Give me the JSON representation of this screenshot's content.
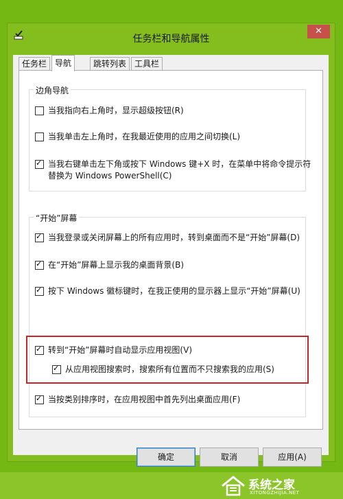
{
  "window": {
    "title": "任务栏和导航属性",
    "close_symbol": "✕"
  },
  "tabs": [
    {
      "label": "任务栏"
    },
    {
      "label": "导航"
    },
    {
      "label": "跳转列表"
    },
    {
      "label": "工具栏"
    }
  ],
  "active_tab": "导航",
  "corner_navigation": {
    "title": "边角导航",
    "options": [
      {
        "label": "当我指向右上角时，显示超级按钮(R)",
        "checked": false
      },
      {
        "label": "当我单击左上角时，在我最近使用的应用之间切换(L)",
        "checked": false
      },
      {
        "label_line1": "当我右键单击左下角或按下 Windows 键+X 时，在菜单中将命令提示符",
        "label_line2": "替换为 Windows PowerShell(C)",
        "checked": true
      }
    ]
  },
  "start_screen": {
    "title": "“开始”屏幕",
    "options": [
      {
        "label": "当我登录或关闭屏幕上的所有应用时，转到桌面而不是“开始”屏幕(D)",
        "checked": true
      },
      {
        "label": "在“开始”屏幕上显示我的桌面背景(B)",
        "checked": true
      },
      {
        "label": "按下 Windows 徽标键时，在我正使用的显示器上显示“开始”屏幕(U)",
        "checked": true
      },
      {
        "label": "转到“开始”屏幕时自动显示应用视图(V)",
        "checked": true
      },
      {
        "label": "从应用视图搜索时，搜索所有位置而不只搜索我的应用(S)",
        "checked": true
      },
      {
        "label": "当按类别排序时，在应用视图中首先列出桌面应用(F)",
        "checked": true
      }
    ]
  },
  "buttons": {
    "ok": "确定",
    "cancel": "取消",
    "apply": "应用(A)"
  },
  "watermark": {
    "text": "系统之家",
    "sub": "XITONGZHIJIA.NET"
  },
  "colors": {
    "background": "#74b814",
    "close_button": "#c7504b",
    "highlight_box": "#c1272d"
  }
}
